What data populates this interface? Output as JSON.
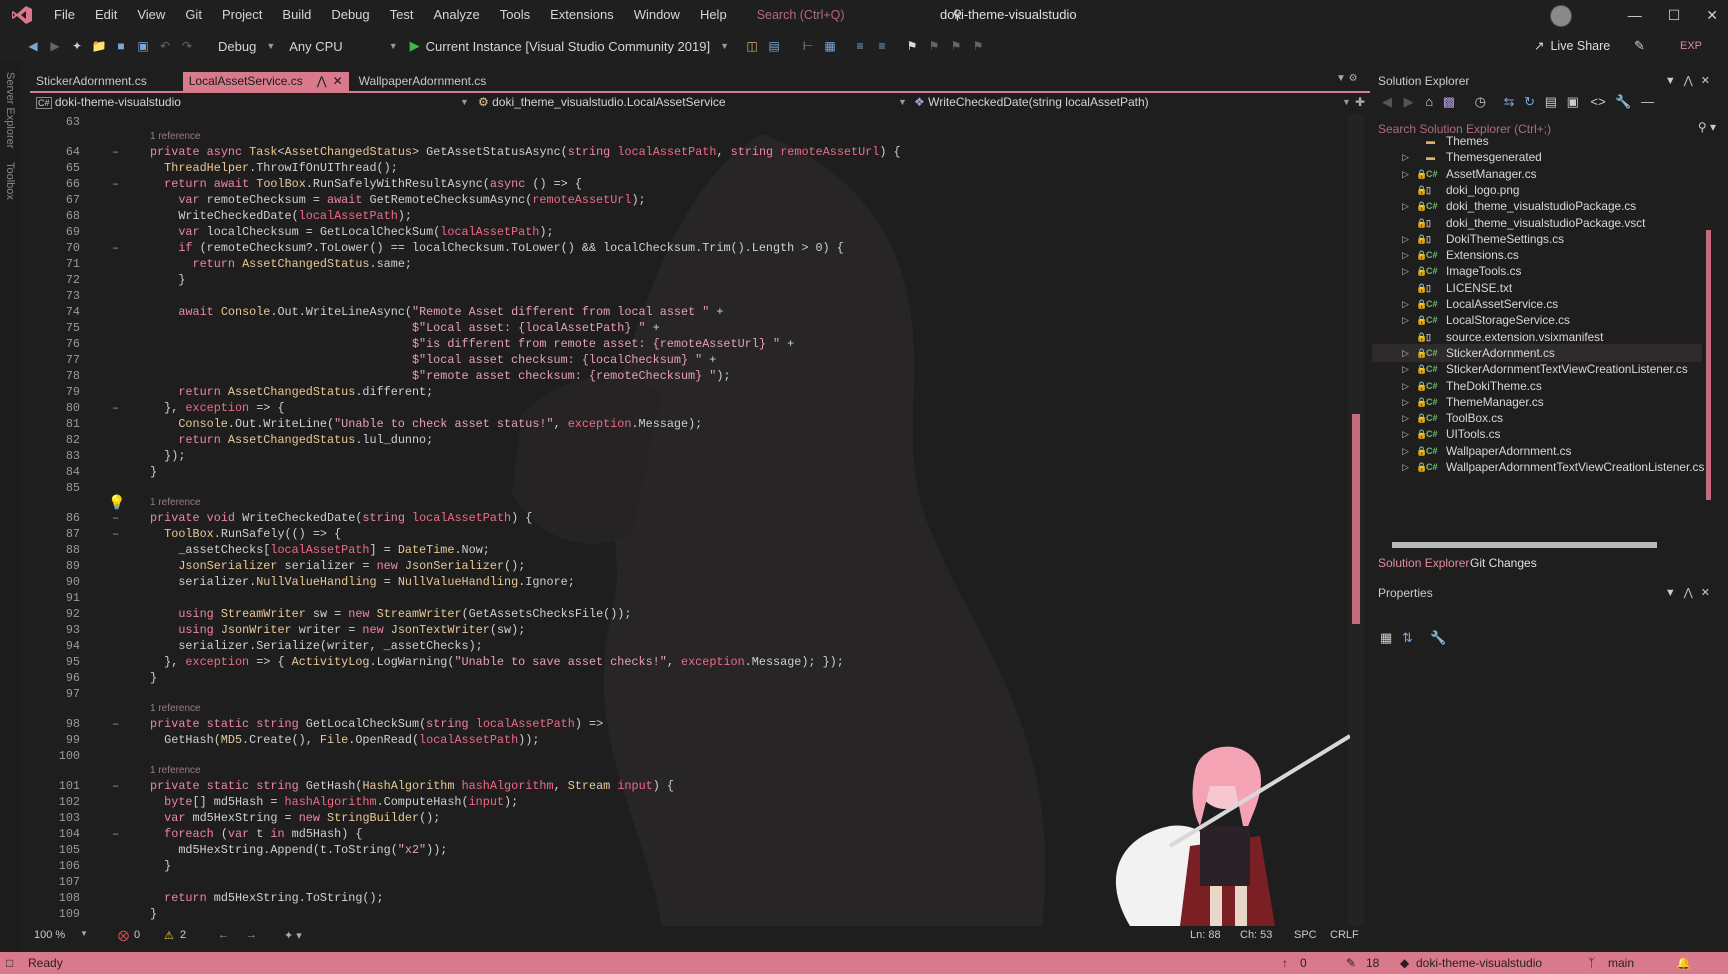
{
  "menubar": {
    "items": [
      "File",
      "Edit",
      "View",
      "Git",
      "Project",
      "Build",
      "Debug",
      "Test",
      "Analyze",
      "Tools",
      "Extensions",
      "Window",
      "Help"
    ],
    "search_placeholder": "Search (Ctrl+Q)",
    "solution_title": "doki-theme-visualstudio"
  },
  "toolbar": {
    "configuration": "Debug",
    "platform": "Any CPU",
    "run_target": "Current Instance [Visual Studio Community 2019]",
    "live_share": "Live Share",
    "exp_badge": "EXP"
  },
  "left_strip": [
    "Server Explorer",
    "Toolbox"
  ],
  "tabs": [
    {
      "label": "StickerAdornment.cs",
      "active": false
    },
    {
      "label": "LocalAssetService.cs",
      "active": true
    },
    {
      "label": "WallpaperAdornment.cs",
      "active": false
    }
  ],
  "navbar": {
    "project": "doki-theme-visualstudio",
    "class": "doki_theme_visualstudio.LocalAssetService",
    "member": "WriteCheckedDate(string localAssetPath)"
  },
  "editor": {
    "reference_label": "1 reference",
    "lines": [
      {
        "n": "63",
        "fold": "",
        "ref": false,
        "text": ""
      },
      {
        "n": "64",
        "fold": "–",
        "ref": true,
        "text": "private async Task<AssetChangedStatus> GetAssetStatusAsync(string localAssetPath, string remoteAssetUrl) {"
      },
      {
        "n": "65",
        "fold": "",
        "ref": false,
        "text": "  ThreadHelper.ThrowIfOnUIThread();"
      },
      {
        "n": "66",
        "fold": "–",
        "ref": false,
        "text": "  return await ToolBox.RunSafelyWithResultAsync(async () => {"
      },
      {
        "n": "67",
        "fold": "",
        "ref": false,
        "text": "    var remoteChecksum = await GetRemoteChecksumAsync(remoteAssetUrl);"
      },
      {
        "n": "68",
        "fold": "",
        "ref": false,
        "text": "    WriteCheckedDate(localAssetPath);"
      },
      {
        "n": "69",
        "fold": "",
        "ref": false,
        "text": "    var localChecksum = GetLocalCheckSum(localAssetPath);"
      },
      {
        "n": "70",
        "fold": "–",
        "ref": false,
        "text": "    if (remoteChecksum?.ToLower() == localChecksum.ToLower() && localChecksum.Trim().Length > 0) {"
      },
      {
        "n": "71",
        "fold": "",
        "ref": false,
        "text": "      return AssetChangedStatus.same;"
      },
      {
        "n": "72",
        "fold": "",
        "ref": false,
        "text": "    }"
      },
      {
        "n": "73",
        "fold": "",
        "ref": false,
        "text": ""
      },
      {
        "n": "74",
        "fold": "",
        "ref": false,
        "text": "    await Console.Out.WriteLineAsync(\"Remote Asset different from local asset \" +"
      },
      {
        "n": "75",
        "fold": "",
        "ref": false,
        "text": "                                     $\"Local asset: {localAssetPath} \" +"
      },
      {
        "n": "76",
        "fold": "",
        "ref": false,
        "text": "                                     $\"is different from remote asset: {remoteAssetUrl} \" +"
      },
      {
        "n": "77",
        "fold": "",
        "ref": false,
        "text": "                                     $\"local asset checksum: {localChecksum} \" +"
      },
      {
        "n": "78",
        "fold": "",
        "ref": false,
        "text": "                                     $\"remote asset checksum: {remoteChecksum} \");"
      },
      {
        "n": "79",
        "fold": "",
        "ref": false,
        "text": "    return AssetChangedStatus.different;"
      },
      {
        "n": "80",
        "fold": "–",
        "ref": false,
        "text": "  }, exception => {"
      },
      {
        "n": "81",
        "fold": "",
        "ref": false,
        "text": "    Console.Out.WriteLine(\"Unable to check asset status!\", exception.Message);"
      },
      {
        "n": "82",
        "fold": "",
        "ref": false,
        "text": "    return AssetChangedStatus.lul_dunno;"
      },
      {
        "n": "83",
        "fold": "",
        "ref": false,
        "text": "  });"
      },
      {
        "n": "84",
        "fold": "",
        "ref": false,
        "text": "}"
      },
      {
        "n": "85",
        "fold": "",
        "ref": false,
        "text": ""
      },
      {
        "n": "86",
        "fold": "–",
        "ref": true,
        "text": "private void WriteCheckedDate(string localAssetPath) {"
      },
      {
        "n": "87",
        "fold": "–",
        "ref": false,
        "text": "  ToolBox.RunSafely(() => {"
      },
      {
        "n": "88",
        "fold": "",
        "ref": false,
        "text": "    _assetChecks[localAssetPath] = DateTime.Now;"
      },
      {
        "n": "89",
        "fold": "",
        "ref": false,
        "text": "    JsonSerializer serializer = new JsonSerializer();"
      },
      {
        "n": "90",
        "fold": "",
        "ref": false,
        "text": "    serializer.NullValueHandling = NullValueHandling.Ignore;"
      },
      {
        "n": "91",
        "fold": "",
        "ref": false,
        "text": ""
      },
      {
        "n": "92",
        "fold": "",
        "ref": false,
        "text": "    using StreamWriter sw = new StreamWriter(GetAssetsChecksFile());"
      },
      {
        "n": "93",
        "fold": "",
        "ref": false,
        "text": "    using JsonWriter writer = new JsonTextWriter(sw);"
      },
      {
        "n": "94",
        "fold": "",
        "ref": false,
        "text": "    serializer.Serialize(writer, _assetChecks);"
      },
      {
        "n": "95",
        "fold": "",
        "ref": false,
        "text": "  }, exception => { ActivityLog.LogWarning(\"Unable to save asset checks!\", exception.Message); });"
      },
      {
        "n": "96",
        "fold": "",
        "ref": false,
        "text": "}"
      },
      {
        "n": "97",
        "fold": "",
        "ref": false,
        "text": ""
      },
      {
        "n": "98",
        "fold": "–",
        "ref": true,
        "text": "private static string GetLocalCheckSum(string localAssetPath) =>"
      },
      {
        "n": "99",
        "fold": "",
        "ref": false,
        "text": "  GetHash(MD5.Create(), File.OpenRead(localAssetPath));"
      },
      {
        "n": "100",
        "fold": "",
        "ref": false,
        "text": ""
      },
      {
        "n": "101",
        "fold": "–",
        "ref": true,
        "text": "private static string GetHash(HashAlgorithm hashAlgorithm, Stream input) {"
      },
      {
        "n": "102",
        "fold": "",
        "ref": false,
        "text": "  byte[] md5Hash = hashAlgorithm.ComputeHash(input);"
      },
      {
        "n": "103",
        "fold": "",
        "ref": false,
        "text": "  var md5HexString = new StringBuilder();"
      },
      {
        "n": "104",
        "fold": "–",
        "ref": false,
        "text": "  foreach (var t in md5Hash) {"
      },
      {
        "n": "105",
        "fold": "",
        "ref": false,
        "text": "    md5HexString.Append(t.ToString(\"x2\"));"
      },
      {
        "n": "106",
        "fold": "",
        "ref": false,
        "text": "  }"
      },
      {
        "n": "107",
        "fold": "",
        "ref": false,
        "text": ""
      },
      {
        "n": "108",
        "fold": "",
        "ref": false,
        "text": "  return md5HexString.ToString();"
      },
      {
        "n": "109",
        "fold": "",
        "ref": false,
        "text": "}"
      }
    ]
  },
  "solution_explorer": {
    "title": "Solution Explorer",
    "search_placeholder": "Search Solution Explorer (Ctrl+;)",
    "items": [
      {
        "label": "Themes",
        "type": "folder",
        "expand": false,
        "lock": false
      },
      {
        "label": "Themesgenerated",
        "type": "folder",
        "expand": true,
        "lock": false
      },
      {
        "label": "AssetManager.cs",
        "type": "cs",
        "expand": true,
        "lock": true
      },
      {
        "label": "doki_logo.png",
        "type": "file",
        "expand": false,
        "lock": true
      },
      {
        "label": "doki_theme_visualstudioPackage.cs",
        "type": "cs",
        "expand": true,
        "lock": true
      },
      {
        "label": "doki_theme_visualstudioPackage.vsct",
        "type": "file",
        "expand": false,
        "lock": true
      },
      {
        "label": "DokiThemeSettings.cs",
        "type": "file",
        "expand": true,
        "lock": true
      },
      {
        "label": "Extensions.cs",
        "type": "cs",
        "expand": true,
        "lock": true
      },
      {
        "label": "ImageTools.cs",
        "type": "cs",
        "expand": true,
        "lock": true
      },
      {
        "label": "LICENSE.txt",
        "type": "file",
        "expand": false,
        "lock": true
      },
      {
        "label": "LocalAssetService.cs",
        "type": "cs",
        "expand": true,
        "lock": true
      },
      {
        "label": "LocalStorageService.cs",
        "type": "cs",
        "expand": true,
        "lock": true
      },
      {
        "label": "source.extension.vsixmanifest",
        "type": "file",
        "expand": false,
        "lock": true
      },
      {
        "label": "StickerAdornment.cs",
        "type": "cs",
        "expand": true,
        "lock": true
      },
      {
        "label": "StickerAdornmentTextViewCreationListener.cs",
        "type": "cs",
        "expand": true,
        "lock": true
      },
      {
        "label": "TheDokiTheme.cs",
        "type": "cs",
        "expand": true,
        "lock": true
      },
      {
        "label": "ThemeManager.cs",
        "type": "cs",
        "expand": true,
        "lock": true
      },
      {
        "label": "ToolBox.cs",
        "type": "cs",
        "expand": true,
        "lock": true
      },
      {
        "label": "UITools.cs",
        "type": "cs",
        "expand": true,
        "lock": true
      },
      {
        "label": "WallpaperAdornment.cs",
        "type": "cs",
        "expand": true,
        "lock": true
      },
      {
        "label": "WallpaperAdornmentTextViewCreationListener.cs",
        "type": "cs",
        "expand": true,
        "lock": true
      }
    ],
    "tabs": [
      "Solution Explorer",
      "Git Changes"
    ]
  },
  "properties": {
    "title": "Properties"
  },
  "editor_status": {
    "zoom": "100 %",
    "errors": "0",
    "warnings": "2",
    "line": "Ln: 88",
    "col": "Ch: 53",
    "spacing": "SPC",
    "eol": "CRLF"
  },
  "statusbar": {
    "ready": "Ready",
    "up_count": "0",
    "edits": "18",
    "repo": "doki-theme-visualstudio",
    "branch": "main"
  },
  "colors": {
    "accent": "#d8798c",
    "keyword": "#ef86a0",
    "type": "#e7c995",
    "string": "#e7a0b4"
  }
}
